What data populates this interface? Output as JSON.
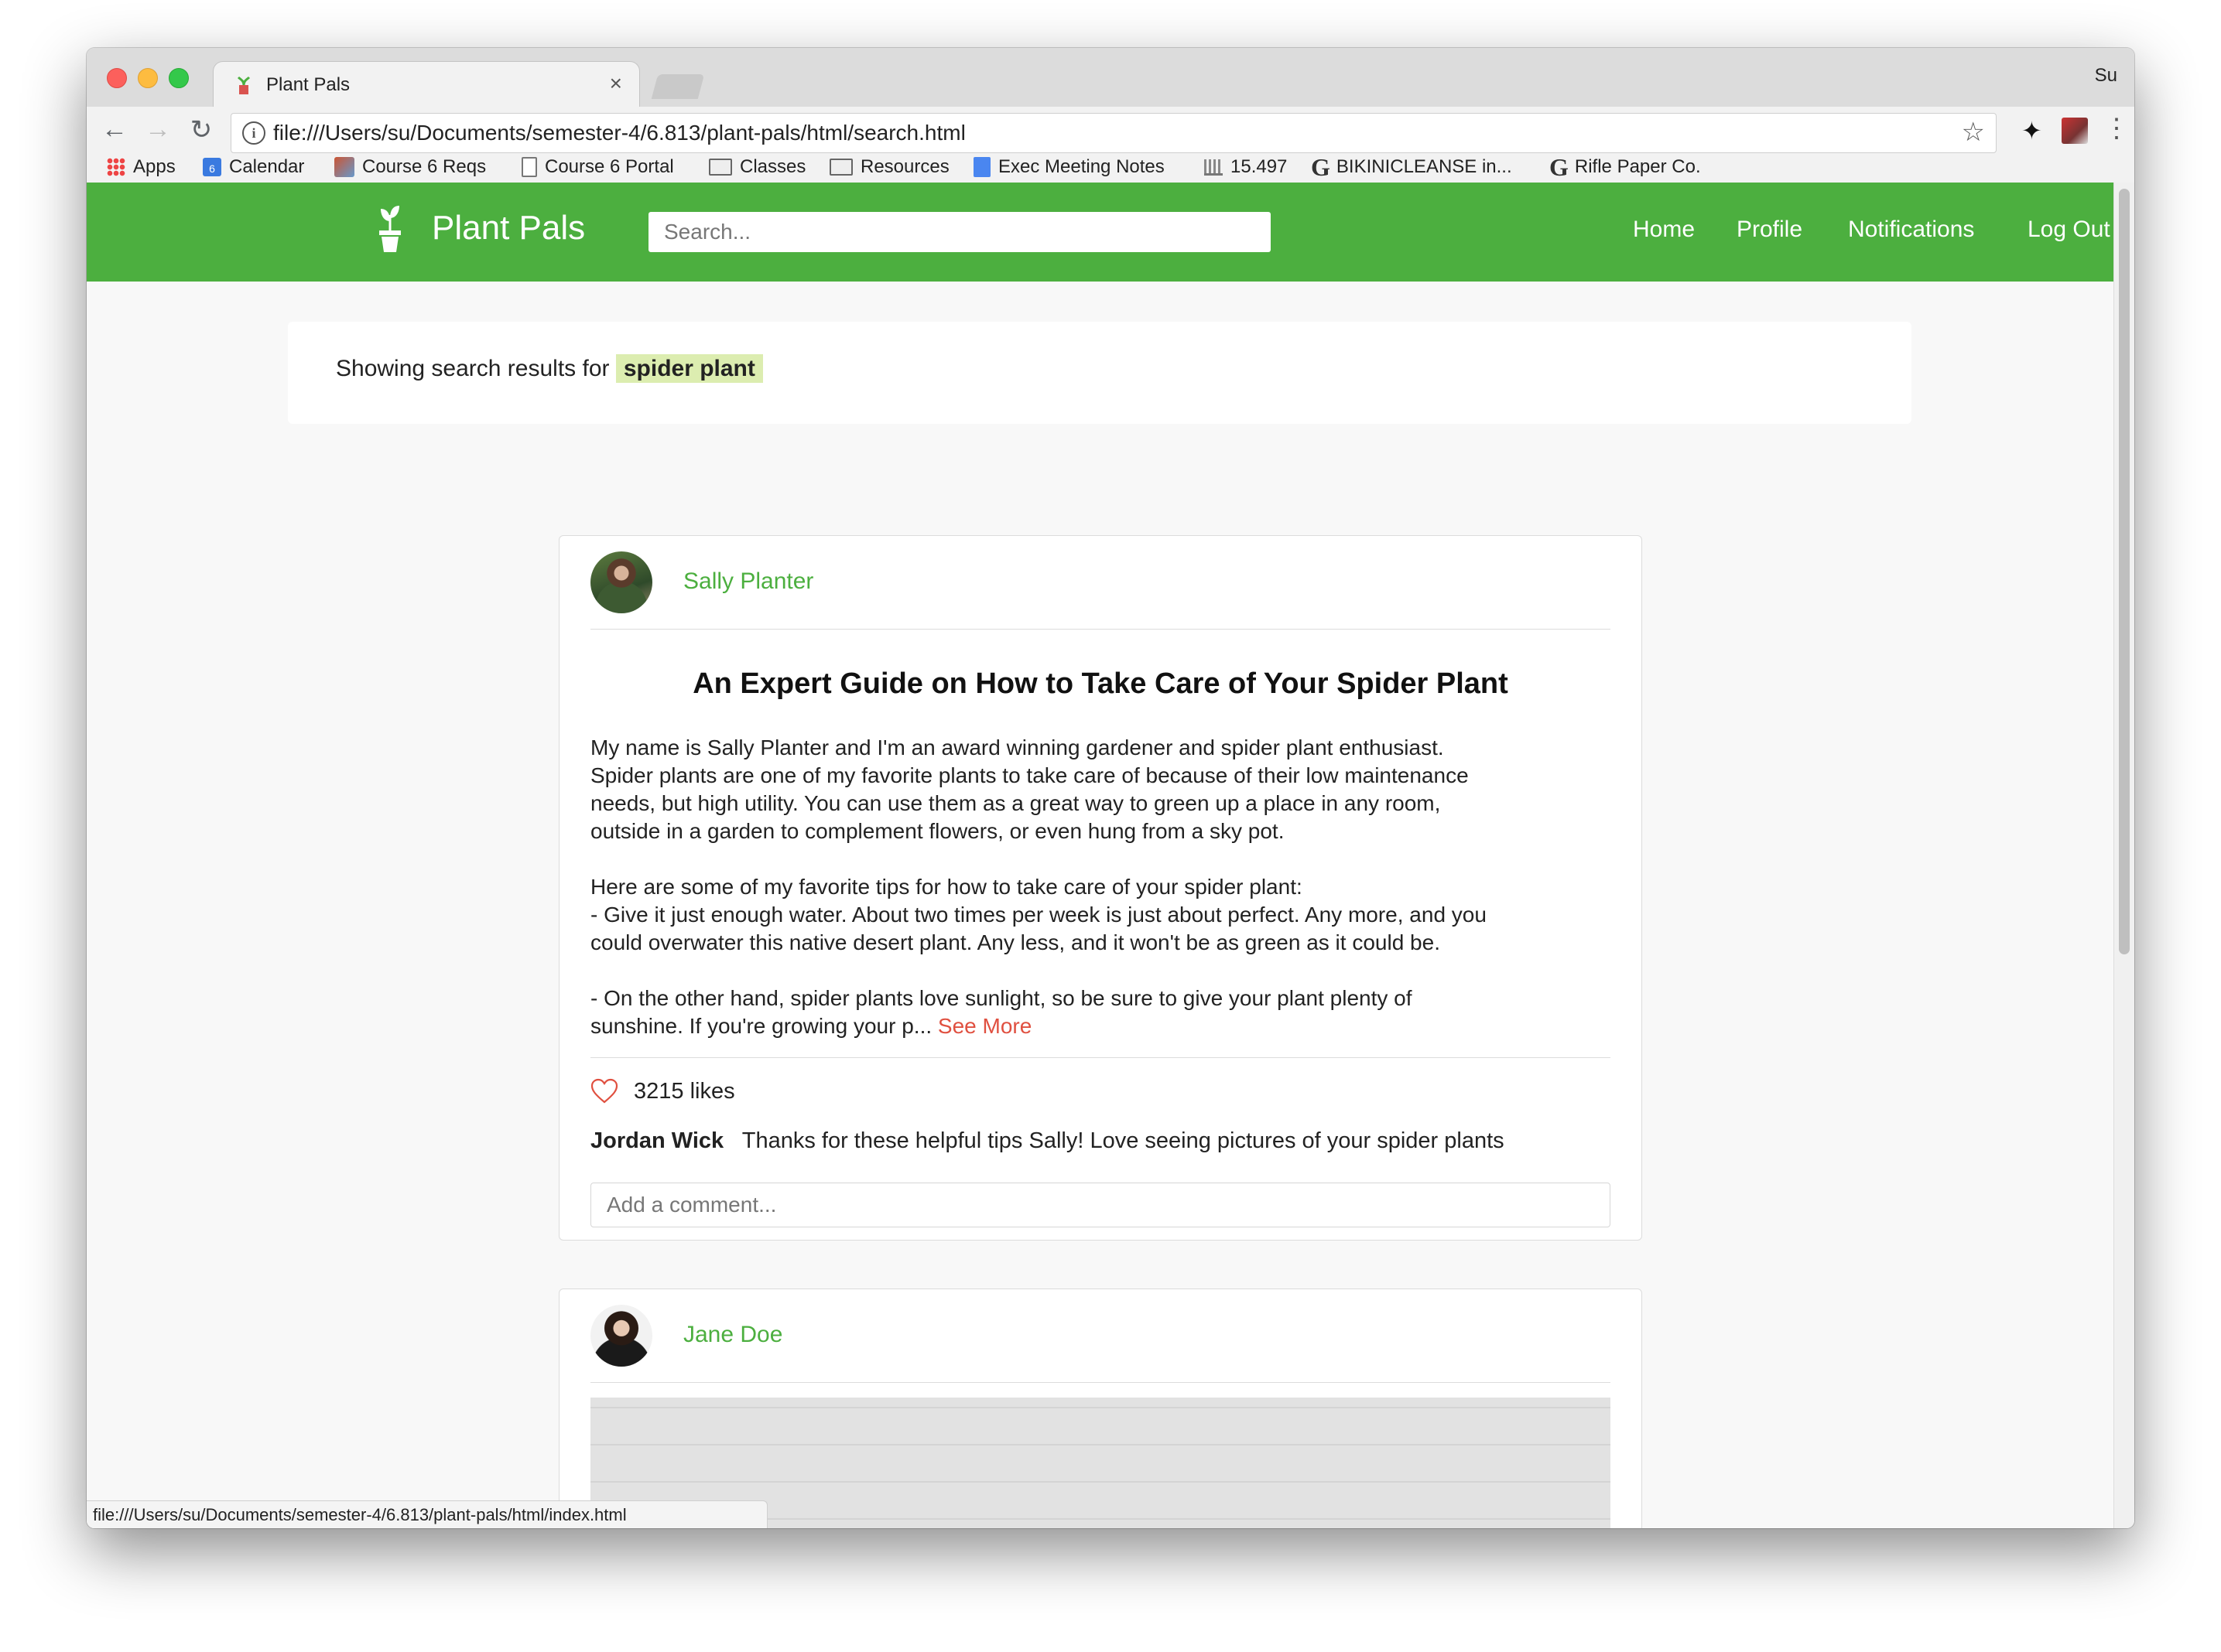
{
  "browser": {
    "tab_title": "Plant Pals",
    "tab_close": "×",
    "profile_name": "Su",
    "url": "file:///Users/su/Documents/semester-4/6.813/plant-pals/html/search.html",
    "status_url": "file:///Users/su/Documents/semester-4/6.813/plant-pals/html/index.html",
    "bookmarks": [
      {
        "label": "Apps",
        "icon": "apps-grid-icon"
      },
      {
        "label": "Calendar",
        "icon": "calendar-icon"
      },
      {
        "label": "Course 6 Reqs",
        "icon": "mit-icon"
      },
      {
        "label": "Course 6 Portal",
        "icon": "page-icon"
      },
      {
        "label": "Classes",
        "icon": "folder-icon"
      },
      {
        "label": "Resources",
        "icon": "folder-icon"
      },
      {
        "label": "Exec Meeting Notes",
        "icon": "google-doc-icon"
      },
      {
        "label": "15.497",
        "icon": "bank-icon"
      },
      {
        "label": "BIKINICLEANSE in...",
        "icon": "g-icon"
      },
      {
        "label": "Rifle Paper Co.",
        "icon": "g-icon"
      }
    ]
  },
  "site": {
    "brand": "Plant Pals",
    "brand_color": "#4caf3f",
    "search_placeholder": "Search...",
    "nav": [
      "Home",
      "Profile",
      "Notifications",
      "Log Out"
    ]
  },
  "results": {
    "prefix": "Showing search results for",
    "query": "spider plant"
  },
  "posts": [
    {
      "author": "Sally Planter",
      "title": "An Expert Guide on How to Take Care of Your Spider Plant",
      "body": "My name is Sally Planter and I'm an award winning gardener and spider plant enthusiast.\nSpider plants are one of my favorite plants to take care of because of their low maintenance\nneeds, but high utility. You can use them as a great way to green up a place in any room,\noutside in a garden to complement flowers, or even hung from a sky pot.\n\nHere are some of my favorite tips for how to take care of your spider plant:\n- Give it just enough water. About two times per week is just about perfect. Any more, and you\ncould overwater this native desert plant. Any less, and it won't be as green as it could be.\n\n- On the other hand, spider plants love sunlight, so be sure to give your plant plenty of\nsunshine. If you're growing your p... ",
      "see_more": "See More",
      "likes": "3215 likes",
      "comment_author": "Jordan Wick",
      "comment_text": "Thanks for these helpful tips Sally! Love seeing pictures of your spider plants",
      "comment_placeholder": "Add a comment..."
    },
    {
      "author": "Jane Doe"
    }
  ]
}
